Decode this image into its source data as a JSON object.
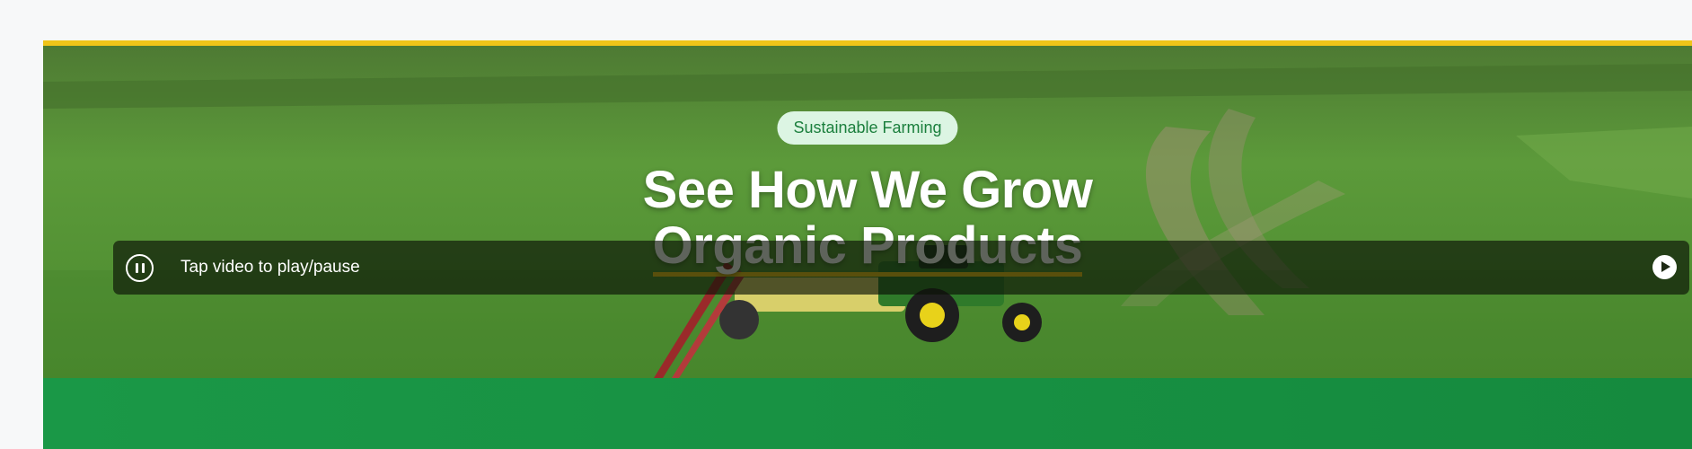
{
  "hero": {
    "badge": "Sustainable Farming",
    "title_line1": "See How We Grow",
    "title_line2": "Organic Products"
  },
  "video_bar": {
    "label": "Tap video to play/pause",
    "left_icon": "pause-icon",
    "right_icon": "play-icon"
  },
  "colors": {
    "accent_yellow": "#f0c419",
    "badge_bg": "#dcf5e3",
    "badge_text": "#1b7f3d",
    "band_green": "#1a9847"
  }
}
